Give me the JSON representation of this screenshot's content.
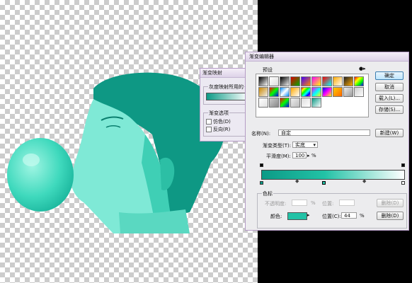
{
  "small_dialog": {
    "title": "渐变映射",
    "group_label": "灰度映射所用的",
    "options_label": "渐变选项",
    "dither_label": "仿色(D)",
    "reverse_label": "反向(R)"
  },
  "gradient_editor": {
    "title": "渐变编辑器",
    "presets_label": "预设",
    "ok_label": "确定",
    "cancel_label": "取消",
    "load_label": "载入(L)...",
    "save_label": "存储(S)...",
    "name_label": "名称(N):",
    "name_value": "自定",
    "new_label": "新建(W)",
    "type_label": "渐变类型(T):",
    "type_value": "实底",
    "smooth_label": "平滑度(M):",
    "smooth_value": "100",
    "smooth_unit": "%",
    "stops_label": "色标",
    "opacity_label": "不透明度:",
    "opacity_unit": "%",
    "location_label_top": "位置:",
    "delete_label_top": "删除(D)",
    "color_label": "颜色:",
    "location_label": "位置(C):",
    "location_value": "44",
    "location_unit": "%",
    "delete_label": "删除(D)",
    "stop_color": "#22c2a6",
    "gradient_start": "#0c9a86",
    "gradient_end": "#ffffff"
  }
}
